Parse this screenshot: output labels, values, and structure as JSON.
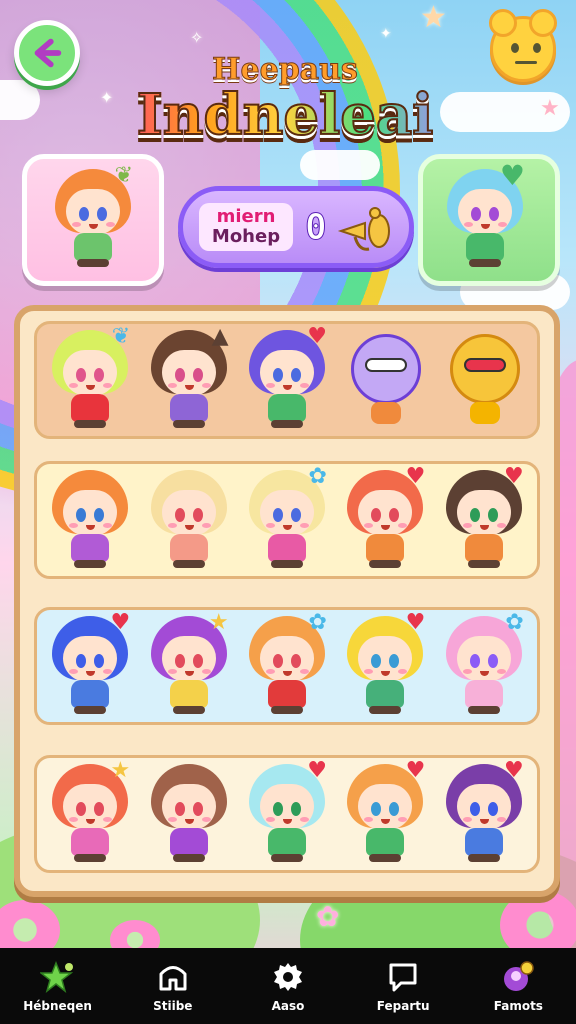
{
  "header": {
    "title_top": "Heepaus",
    "title_main": "Indneleai"
  },
  "score": {
    "label_line1": "miern",
    "label_line2": "Mohep",
    "value": "0"
  },
  "icons": {
    "back": "back-arrow-icon",
    "mood": "smiley-face-icon",
    "trumpet": "trumpet-icon"
  },
  "colors": {
    "row1": "#f4c8a0",
    "row2": "#fff3c9",
    "row3": "#d8f1fb",
    "row4": "#fdf3dc",
    "nav_bg": "#0a0a0a"
  },
  "grid": {
    "rows": [
      [
        {
          "hair": "#d8f060",
          "eyes": "#e0558c",
          "body": "#e8343c",
          "acc": "bow-icon"
        },
        {
          "hair": "#6b4430",
          "eyes": "#d94f8a",
          "body": "#8e65d6",
          "acc": "cat-ears-icon"
        },
        {
          "hair": "#6e55e0",
          "eyes": "#4b6be0",
          "body": "#48b86a",
          "acc": "heart-icon"
        },
        {
          "hair": "robot",
          "eyes": "#333",
          "body": "#f08a3c",
          "acc": "robot-icon"
        },
        {
          "hair": "emoji",
          "eyes": "#333",
          "body": "#f4b400",
          "acc": "emoji-icon"
        }
      ],
      [
        {
          "hair": "#f58a3c",
          "eyes": "#3a7bd5",
          "body": "#b15bd6",
          "acc": ""
        },
        {
          "hair": "#f7dfa0",
          "eyes": "#e24b5c",
          "body": "#f49a88",
          "acc": ""
        },
        {
          "hair": "#f7e6a0",
          "eyes": "#4b6be0",
          "body": "#e85aa5",
          "acc": "flower-icon"
        },
        {
          "hair": "#f26a4a",
          "eyes": "#e24b5c",
          "body": "#f08a3c",
          "acc": "heart-icon"
        },
        {
          "hair": "#5c4033",
          "eyes": "#2e9c58",
          "body": "#f08a3c",
          "acc": "heart-icon"
        }
      ],
      [
        {
          "hair": "#3e5ee8",
          "eyes": "#3e5ee8",
          "body": "#4a7be0",
          "acc": "heart-icon"
        },
        {
          "hair": "#a34bd6",
          "eyes": "#e24b5c",
          "body": "#f4d14a",
          "acc": "star-icon"
        },
        {
          "hair": "#f5a04a",
          "eyes": "#e24b5c",
          "body": "#e23b3b",
          "acc": "flower-icon"
        },
        {
          "hair": "#f7d73a",
          "eyes": "#3a9bd5",
          "body": "#46b07a",
          "acc": "heart-icon"
        },
        {
          "hair": "#f7a6d8",
          "eyes": "#8b5cf6",
          "body": "#f7b0d8",
          "acc": "flower-icon"
        }
      ],
      [
        {
          "hair": "#f26a4a",
          "eyes": "#e24b5c",
          "body": "#e86ab8",
          "acc": "star-icon"
        },
        {
          "hair": "#a0624a",
          "eyes": "#e24b5c",
          "body": "#a34bd6",
          "acc": ""
        },
        {
          "hair": "#a6e8f0",
          "eyes": "#2e9c58",
          "body": "#48b86a",
          "acc": "heart-icon"
        },
        {
          "hair": "#f5a04a",
          "eyes": "#3a9bd5",
          "body": "#48b86a",
          "acc": "heart-icon"
        },
        {
          "hair": "#7a3ea8",
          "eyes": "#3e5ee8",
          "body": "#4a7be0",
          "acc": "heart-icon"
        }
      ]
    ]
  },
  "nav": {
    "items": [
      {
        "label": "Hébneqen",
        "icon": "star-icon"
      },
      {
        "label": "Stiibe",
        "icon": "house-icon"
      },
      {
        "label": "Aaso",
        "icon": "gear-icon"
      },
      {
        "label": "Fepartu",
        "icon": "chat-icon"
      },
      {
        "label": "Famots",
        "icon": "profile-badge-icon"
      }
    ]
  }
}
